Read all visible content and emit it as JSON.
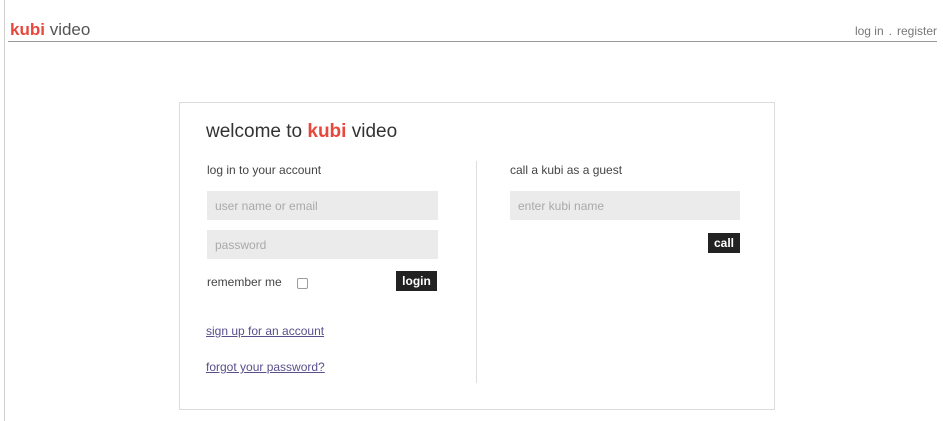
{
  "header": {
    "brand_strong": "kubi",
    "brand_light": "video",
    "login_link": "log in",
    "separator": ".",
    "register_link": "register"
  },
  "card": {
    "title_prefix": "welcome to ",
    "title_highlight": "kubi",
    "title_suffix": " video",
    "login": {
      "heading": "log in to your account",
      "username_placeholder": "user name or email",
      "password_placeholder": "password",
      "remember_label": "remember me",
      "remember_checked": false,
      "login_button": "login",
      "signup_link": "sign up for an account",
      "forgot_link": "forgot your password?"
    },
    "guest": {
      "heading": "call a kubi as a guest",
      "kubi_name_placeholder": "enter kubi name",
      "call_button": "call"
    }
  },
  "colors": {
    "accent": "#e8473b",
    "button_bg": "#222222",
    "input_bg": "#ebebeb",
    "link": "#5a4f8b"
  }
}
